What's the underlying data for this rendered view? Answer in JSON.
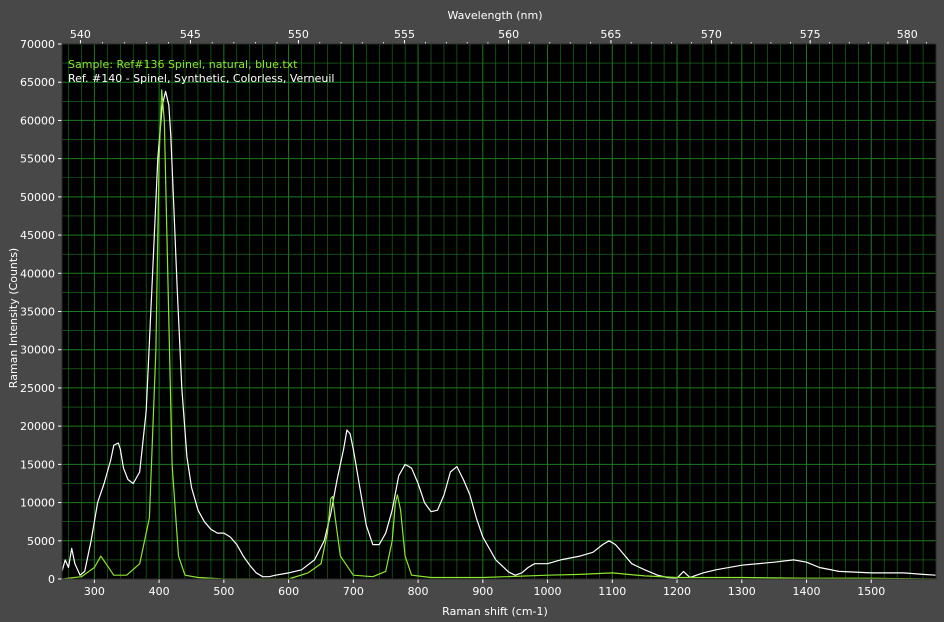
{
  "chart_data": {
    "type": "line",
    "title": "",
    "xlabel": "Raman shift (cm-1)",
    "ylabel": "Raman Intensity (Counts)",
    "x2label": "Wavelength (nm)",
    "xlim": [
      250,
      1600
    ],
    "ylim": [
      0,
      70000
    ],
    "x_ticks": [
      300,
      400,
      500,
      600,
      700,
      800,
      900,
      1000,
      1100,
      1200,
      1300,
      1400,
      1500
    ],
    "y_ticks": [
      0,
      5000,
      10000,
      15000,
      20000,
      25000,
      30000,
      35000,
      40000,
      45000,
      50000,
      55000,
      60000,
      65000,
      70000
    ],
    "x2_ticks": [
      540,
      545,
      550,
      555,
      560,
      565,
      570,
      575,
      580
    ],
    "grid": true,
    "colors": {
      "background": "#000000",
      "frame": "#484848",
      "grid": "#1f7a1f",
      "sample": "#8ce62e",
      "reference": "#ffffff"
    },
    "series": [
      {
        "name": "Sample: Ref#136 Spinel, natural, blue.txt",
        "color": "#8ce62e",
        "x": [
          250,
          280,
          300,
          310,
          318,
          330,
          350,
          370,
          385,
          395,
          400,
          404,
          408,
          412,
          420,
          430,
          440,
          460,
          500,
          550,
          600,
          630,
          650,
          660,
          665,
          668,
          672,
          680,
          700,
          730,
          750,
          760,
          765,
          768,
          773,
          780,
          790,
          820,
          900,
          1000,
          1050,
          1100,
          1150,
          1200,
          1300,
          1400,
          1500,
          1600
        ],
        "y": [
          0,
          300,
          1500,
          3000,
          2000,
          500,
          500,
          2000,
          8000,
          30000,
          55000,
          64000,
          60000,
          45000,
          15000,
          3000,
          500,
          200,
          0,
          0,
          0,
          800,
          2000,
          6000,
          10500,
          10800,
          8000,
          3000,
          500,
          300,
          1000,
          5000,
          10000,
          11000,
          9000,
          3000,
          500,
          200,
          200,
          500,
          600,
          800,
          400,
          200,
          200,
          100,
          100,
          0
        ]
      },
      {
        "name": "Ref. #140 - Spinel, Synthetic, Colorless, Verneuil",
        "color": "#ffffff",
        "x": [
          250,
          255,
          260,
          265,
          270,
          278,
          285,
          295,
          305,
          315,
          325,
          330,
          337,
          340,
          345,
          352,
          360,
          370,
          380,
          390,
          398,
          405,
          410,
          415,
          418,
          422,
          428,
          435,
          443,
          450,
          460,
          470,
          480,
          490,
          500,
          510,
          520,
          530,
          540,
          550,
          560,
          570,
          580,
          600,
          620,
          640,
          655,
          665,
          675,
          685,
          690,
          695,
          700,
          710,
          720,
          730,
          740,
          750,
          760,
          770,
          780,
          790,
          800,
          810,
          820,
          830,
          840,
          850,
          860,
          870,
          880,
          890,
          900,
          920,
          940,
          950,
          960,
          970,
          980,
          1000,
          1020,
          1050,
          1070,
          1085,
          1095,
          1105,
          1115,
          1130,
          1150,
          1170,
          1185,
          1200,
          1210,
          1220,
          1230,
          1240,
          1260,
          1300,
          1350,
          1380,
          1400,
          1420,
          1450,
          1500,
          1550,
          1580,
          1600
        ],
        "y": [
          1000,
          2500,
          1500,
          4000,
          2000,
          500,
          1000,
          5000,
          10000,
          12500,
          15500,
          17500,
          17800,
          17000,
          14500,
          13000,
          12500,
          14000,
          22000,
          40000,
          55000,
          62000,
          63800,
          62000,
          58000,
          50000,
          38000,
          25000,
          16000,
          12000,
          9000,
          7500,
          6500,
          6000,
          6000,
          5500,
          4500,
          3000,
          1800,
          800,
          300,
          300,
          500,
          800,
          1200,
          2500,
          5000,
          8500,
          13000,
          17000,
          19500,
          19000,
          17000,
          12000,
          7000,
          4500,
          4500,
          6000,
          9000,
          13500,
          15000,
          14500,
          12500,
          10000,
          8800,
          9000,
          11000,
          14000,
          14700,
          13000,
          11000,
          8000,
          5500,
          2500,
          900,
          500,
          800,
          1500,
          2000,
          2000,
          2500,
          3000,
          3500,
          4500,
          5000,
          4500,
          3500,
          2000,
          1200,
          500,
          200,
          100,
          1000,
          200,
          500,
          800,
          1200,
          1800,
          2200,
          2500,
          2200,
          1500,
          1000,
          800,
          800,
          600,
          500
        ]
      }
    ]
  }
}
